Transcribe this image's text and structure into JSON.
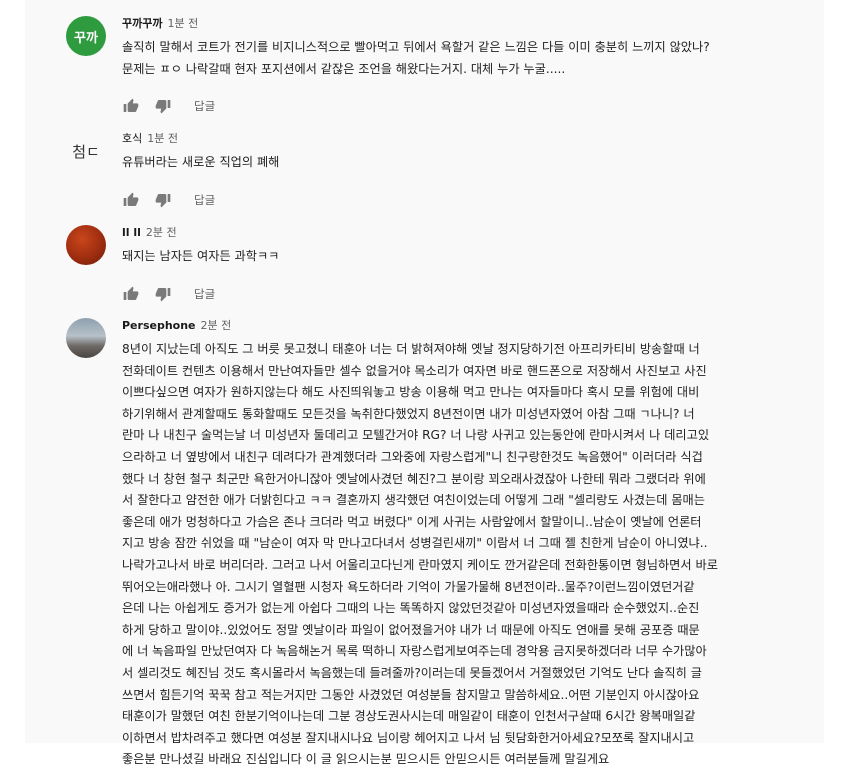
{
  "comments": [
    {
      "author": "꾸까꾸까",
      "time": "1분 전",
      "avatar_text": "꾸까",
      "lines": [
        "솔직히 말해서 코트가 전기를 비지니스적으로 빨아먹고 뒤에서 욕할거 같은 느낌은 다들 이미 충분히 느끼지 않았나?",
        "문제는 ㅍㅇ 나락갈때 현자 포지션에서 같잖은 조언을 해왔다는거지. 대체 누가 누굴....."
      ],
      "reply_label": "답글"
    },
    {
      "author": "호식",
      "time": "1분 전",
      "avatar_text": "첨ㄷ",
      "lines": [
        "유튜버라는 새로운 직업의 폐해"
      ],
      "reply_label": "답글"
    },
    {
      "author": "ll ll",
      "time": "2분 전",
      "lines": [
        "돼지는 남자든 여자든 과학ㅋㅋ"
      ],
      "reply_label": "답글"
    },
    {
      "author": "Persephone",
      "time": "2분 전",
      "lines": [
        "8년이 지났는데 아직도 그 버릇 못고쳤니 태훈아 너는 더 밝혀져야해 옛날 정지당하기전 아프리카티비 방송할때 너",
        "전화데이트 컨텐츠 이용해서 만난여자들만 셀수 없을거야 목소리가 여자면 바로 핸드폰으로 저장해서 사진보고 사진",
        "이쁘다싶으면 여자가 원하지않는다 해도 사진띄워놓고 방송 이용해 먹고 만나는 여자들마다 혹시 모를 위험에 대비",
        "하기위해서 관계할때도 통화할때도 모든것을 녹취한다했었지 8년전이면 내가 미성년자였어 아참 그때 ㄱ나니? 너",
        "란마 나 내친구 술먹는날 너 미성년자 둘데리고 모텔간거야 RG? 너 나랑 사귀고 있는동안에 란마시켜서 나 데리고있",
        "으라하고 너 옆방에서 내친구 데려다가 관계했더라 그와중에 자랑스럽게\"니 친구랑한것도 녹음했어\" 이러더라 식겁",
        "했다 너 창현 철구 최군만 욕한거아니잖아 옛날에사겼던 혜진?그 분이랑 꾀오래사겼잖아 나한테 뭐라 그랬더라 위에",
        "서 잘한다고 얌전한 애가 더밝힌다고 ㅋㅋ 결혼까지 생각했던 여친이었는데 어떻게 그래 \"셀리랑도 사겼는데 몸매는",
        "좋은데 애가 멍청하다고 가슴은 존나 크더라 먹고 버렸다\" 이게 사귀는 사람앞에서 할말이니..남순이 옛날에 언론터",
        "지고 방송 잠깐 쉬었을 때 \"남순이 여자 막 만나고다녀서 성병걸린새끼\" 이람서 너 그때 젤 친한게 남순이 아니였냐..",
        "나락가고나서 바로 버리더라. 그러고 나서 어울리고다닌게 란마였지 케이도 깐거같은데 전화한통이면 형님하면서 바로",
        "뛰어오는애라했나 아. 그시기 열혈팬 시청자 욕도하더라 기억이 가물가물해 8년전이라..물주?이런느낌이였던거같",
        "은데 나는 아쉽게도 증거가 없는게 아쉽다 그때의 나는 똑똑하지 않았던것같아 미성년자였을때라 순수했었지..순진",
        "하게 당하고 말이야..있었어도 정말 옛날이라 파일이 없어졌을거야 내가 너 때문에 아직도 연애를 못해 공포증 때문",
        "에 너 녹음파일 만났던여자 다 녹음해논거 목록 떡하니 자랑스럽게보여주는데 경악용 금지못하겠더라 너무 수가많아",
        "서 셀리것도 혜진님 것도 혹시몰라서 녹음했는데 들려줄까?이러는데 못들겠어서 거절했었던 기억도 난다 솔직히 글",
        "쓰면서 힘든기억 꾹꾹 참고 적는거지만 그동안 사겼었던 여성분들 참지말고 말씀하세요..어떤 기분인지 아시잖아요",
        "태훈이가 말했던 여친 한분기억이나는데 그분 경상도권사시는데 매일같이 태훈이 인천서구살때 6시간 왕복매일같",
        "이하면서 밥차려주고 했다면 여성분 잘지내시나요 님이랑 헤어지고 나서 님 뒷담화한거아세요?모쪼록 잘지내시고",
        "좋은분 만나셨길 바래요 진심입니다 이 글 읽으시는분 믿으시든 안믿으시든 여러분들께 말길게요"
      ]
    }
  ]
}
